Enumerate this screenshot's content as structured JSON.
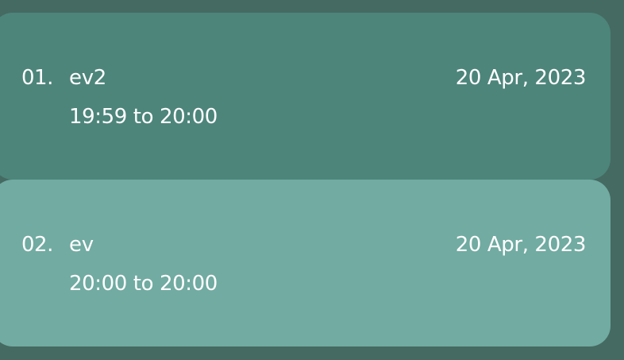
{
  "events": [
    {
      "index": "01.",
      "name": "ev2",
      "time": "19:59 to 20:00",
      "date": "20 Apr, 2023"
    },
    {
      "index": "02.",
      "name": "ev",
      "time": "20:00 to 20:00",
      "date": "20 Apr, 2023"
    }
  ],
  "colors": {
    "background": "#456a62",
    "card_primary": "#4d857b",
    "card_secondary": "#71aba2",
    "text": "#ffffff"
  }
}
